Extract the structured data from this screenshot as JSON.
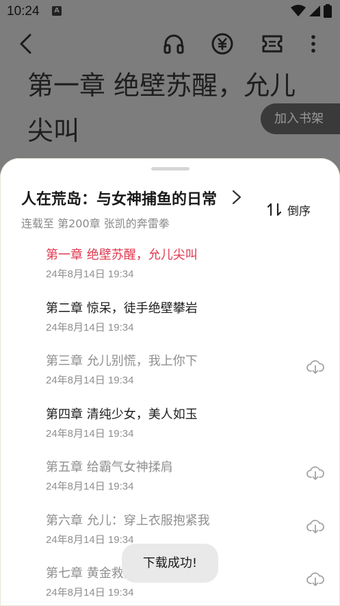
{
  "status_bar": {
    "time": "10:24",
    "notification_icon": "A"
  },
  "reader": {
    "chapter_heading": "第一章 绝壁苏醒，允儿尖叫",
    "add_to_shelf": "加入书架"
  },
  "toolbar_icons": [
    "back-icon",
    "headphones-icon",
    "yuan-coin-icon",
    "ticket-icon",
    "more-vert-icon"
  ],
  "sheet": {
    "book_title": "人在荒岛：与女神捕鱼的日常",
    "serial_status": "连载至 第200章 张凯的奔雷拳",
    "sort_label": "倒序",
    "chapters": [
      {
        "title": "第一章 绝壁苏醒，允儿尖叫",
        "date": "24年8月14日 19:34",
        "state": "current",
        "download": false
      },
      {
        "title": "第二章 惊呆，徒手绝壁攀岩",
        "date": "24年8月14日 19:34",
        "state": "downloaded",
        "download": false
      },
      {
        "title": "第三章 允儿别慌，我上你下",
        "date": "24年8月14日 19:34",
        "state": "not-downloaded",
        "download": true
      },
      {
        "title": "第四章 清纯少女，美人如玉",
        "date": "24年8月14日 19:34",
        "state": "downloaded",
        "download": false
      },
      {
        "title": "第五章 给霸气女神揉肩",
        "date": "24年8月14日 19:34",
        "state": "not-downloaded",
        "download": true
      },
      {
        "title": "第六章 允儿：穿上衣服抱紧我",
        "date": "24年8月14日 19:34",
        "state": "not-downloaded",
        "download": true
      },
      {
        "title": "第七章 黄金救援12小时",
        "date": "24年8月14日 19:34",
        "state": "not-downloaded",
        "download": true
      }
    ]
  },
  "toast": "下载成功!",
  "colors": {
    "current": "#e0384f",
    "downloaded": "#1e1e1e",
    "not_downloaded": "#8f8f8f",
    "icon_gray": "#9a9a9a"
  }
}
